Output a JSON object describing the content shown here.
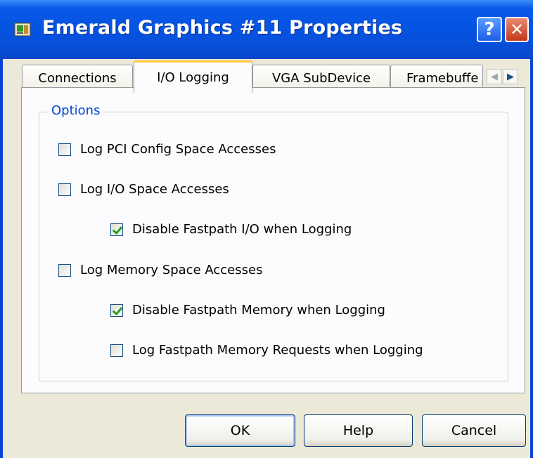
{
  "window": {
    "title": "Emerald Graphics #11 Properties",
    "help_glyph": "?",
    "close_glyph": "✕",
    "title_icon": "device-properties-icon"
  },
  "tabs": [
    {
      "label": "Connections",
      "active": false
    },
    {
      "label": "I/O Logging",
      "active": true
    },
    {
      "label": "VGA SubDevice",
      "active": false
    },
    {
      "label": "Framebuffe",
      "active": false
    }
  ],
  "tab_scroll": {
    "left": "◀",
    "right": "▶"
  },
  "options": {
    "group_label": "Options",
    "items": [
      {
        "label": "Log PCI Config Space Accesses",
        "checked": false
      },
      {
        "label": "Log I/O Space Accesses",
        "checked": false
      },
      {
        "label": "Disable Fastpath I/O when Logging",
        "checked": true
      },
      {
        "label": "Log Memory Space Accesses",
        "checked": false
      },
      {
        "label": "Disable Fastpath Memory when Logging",
        "checked": true
      },
      {
        "label": "Log Fastpath Memory Requests when Logging",
        "checked": false
      }
    ]
  },
  "buttons": {
    "ok": "OK",
    "help": "Help",
    "cancel": "Cancel"
  },
  "colors": {
    "titlebar": "#0654e3",
    "active_tab_accent": "#ffc83c",
    "group_label": "#0046d5",
    "checkmark": "#21a121"
  }
}
